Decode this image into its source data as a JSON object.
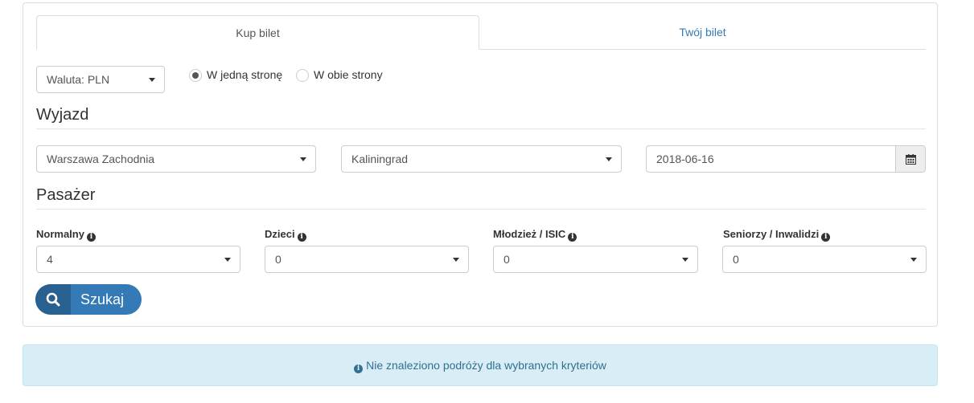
{
  "tabs": [
    {
      "label": "Kup bilet",
      "active": true
    },
    {
      "label": "Twój bilet",
      "active": false
    }
  ],
  "currency": {
    "value": "Waluta: PLN"
  },
  "trip_type": {
    "one_way_label": "W jedną stronę",
    "round_trip_label": "W obie strony",
    "selected": "one_way"
  },
  "departure": {
    "heading": "Wyjazd",
    "from": "Warszawa Zachodnia",
    "to": "Kaliningrad",
    "date": "2018-06-16"
  },
  "passengers": {
    "heading": "Pasażer",
    "groups": [
      {
        "label": "Normalny",
        "value": "4"
      },
      {
        "label": "Dzieci",
        "value": "0"
      },
      {
        "label": "Młodzież / ISIC",
        "value": "0"
      },
      {
        "label": "Seniorzy / Inwalidzi",
        "value": "0"
      }
    ]
  },
  "search_button": {
    "label": "Szukaj"
  },
  "alert": {
    "message": "Nie znaleziono podróży dla wybranych kryteriów"
  },
  "colors": {
    "primary": "#337ab7",
    "alert_bg": "#d9edf7",
    "alert_text": "#31708f"
  },
  "icons": {
    "info": "info-circle-icon",
    "calendar": "calendar-icon",
    "search": "search-icon"
  }
}
